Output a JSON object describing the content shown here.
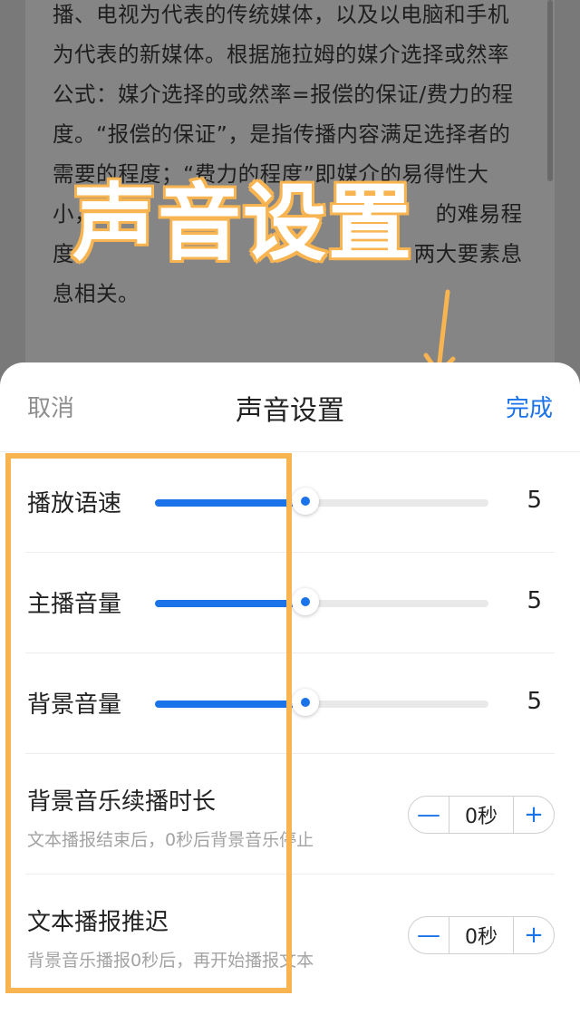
{
  "article": {
    "lines": [
      "播、电视为代表的传统媒体，以及以电脑和手机",
      "为代表的新媒体。根据施拉姆的媒介选择或然率",
      "公式：媒介选择的或然率=报偿的保证/费力的程",
      "度。“报偿的保证”，是指传播内容满足选择者的",
      "需要的程度；“费力的程度”即媒介的易得性大",
      "小，                                               的难易程",
      "度                                               两大要素息",
      "息相关。"
    ]
  },
  "overlay": {
    "title": "声音设置",
    "accent": "#f7b451"
  },
  "sheet": {
    "cancel_label": "取消",
    "title": "声音设置",
    "done_label": "完成",
    "accent": "#1a73e8",
    "sliders": [
      {
        "label": "播放语速",
        "value": "5",
        "fraction": 0.45
      },
      {
        "label": "主播音量",
        "value": "5",
        "fraction": 0.45
      },
      {
        "label": "背景音量",
        "value": "5",
        "fraction": 0.45
      }
    ],
    "steppers": [
      {
        "label": "背景音乐续播时长",
        "sub": "文本播报结束后，0秒后背景音乐停止",
        "value": "0秒",
        "minus": "—",
        "plus": "+"
      },
      {
        "label": "文本播报推迟",
        "sub": "背景音乐播报0秒后，再开始播报文本",
        "value": "0秒",
        "minus": "—",
        "plus": "+"
      }
    ]
  }
}
